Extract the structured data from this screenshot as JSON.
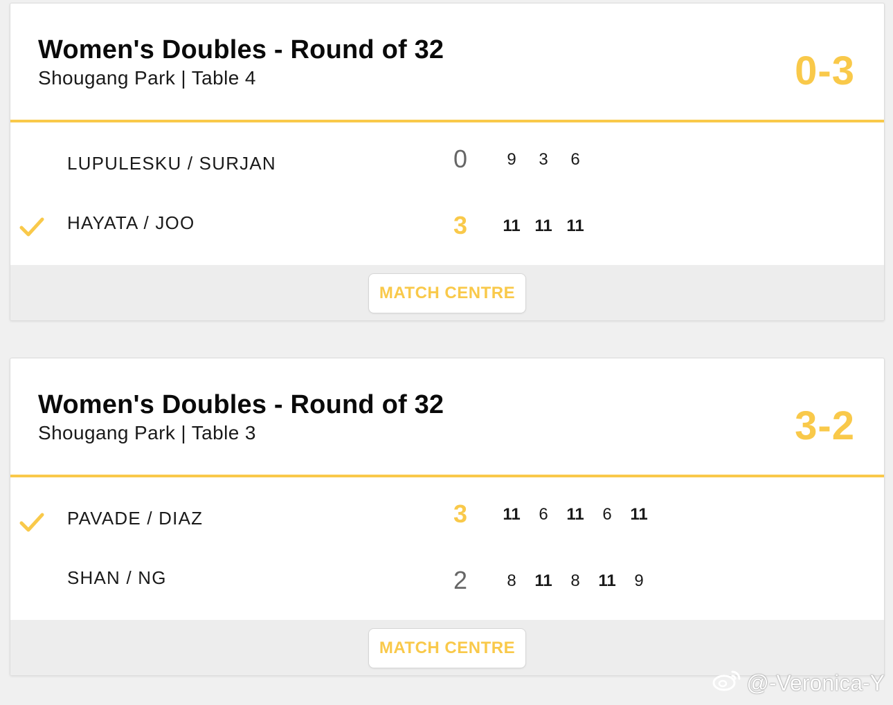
{
  "matches": [
    {
      "title": "Women's Doubles - Round of 32",
      "venue": "Shougang Park | Table 4",
      "overall": "0-3",
      "button": "MATCH CENTRE",
      "teams": [
        {
          "name": "LUPULESKU / SURJAN",
          "winner": false,
          "sets": "0",
          "games": [
            "9",
            "3",
            "6"
          ]
        },
        {
          "name": "HAYATA / JOO",
          "winner": true,
          "sets": "3",
          "games": [
            "11",
            "11",
            "11"
          ]
        }
      ]
    },
    {
      "title": "Women's Doubles - Round of 32",
      "venue": "Shougang Park | Table 3",
      "overall": "3-2",
      "button": "MATCH CENTRE",
      "teams": [
        {
          "name": "PAVADE / DIAZ",
          "winner": true,
          "sets": "3",
          "games": [
            "11",
            "6",
            "11",
            "6",
            "11"
          ]
        },
        {
          "name": "SHAN / NG",
          "winner": false,
          "sets": "2",
          "games": [
            "8",
            "11",
            "8",
            "11",
            "9"
          ]
        }
      ]
    }
  ],
  "watermark": "@-Veronica-Y",
  "colors": {
    "accent": "#f9c94a",
    "text": "#1a1a1a",
    "footer": "#ededed"
  },
  "icons": {
    "winner": "checkmark-icon",
    "watermark": "weibo-icon"
  }
}
